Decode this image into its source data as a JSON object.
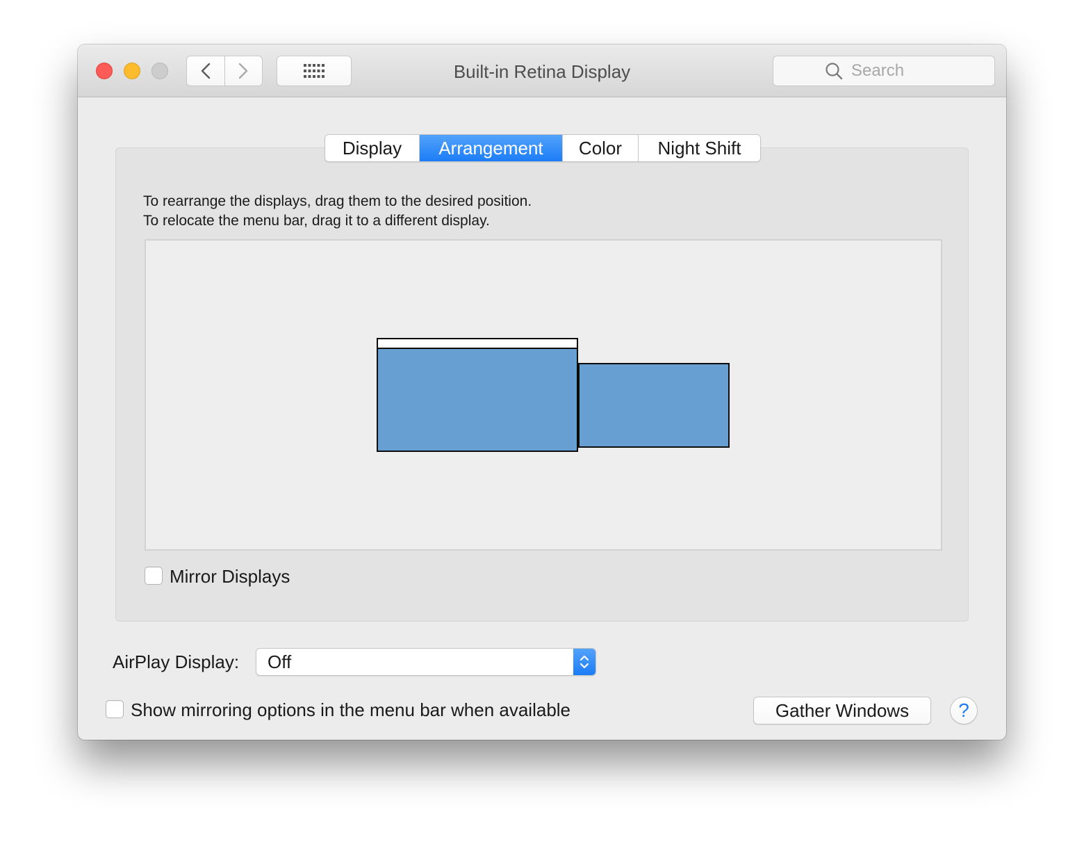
{
  "window": {
    "title": "Built-in Retina Display",
    "traffic_lights": {
      "close_color": "#fc5b57",
      "minimize_color": "#fdbb2e",
      "zoom_color": "#cdcdcd"
    }
  },
  "toolbar": {
    "back_icon": "chevron-left-icon",
    "forward_icon": "chevron-right-icon",
    "show_all_icon": "grid-icon",
    "search": {
      "placeholder": "Search",
      "value": "",
      "icon": "search-icon"
    }
  },
  "tabs": [
    {
      "label": "Display",
      "active": false
    },
    {
      "label": "Arrangement",
      "active": true
    },
    {
      "label": "Color",
      "active": false
    },
    {
      "label": "Night Shift",
      "active": false
    }
  ],
  "arrangement": {
    "instruction_line1": "To rearrange the displays, drag them to the desired position.",
    "instruction_line2": "To relocate the menu bar, drag it to a different display.",
    "display_color": "#689fd3",
    "mirror_displays": {
      "label": "Mirror Displays",
      "checked": false
    }
  },
  "airplay": {
    "label": "AirPlay Display:",
    "selected": "Off"
  },
  "mirroring_options": {
    "label": "Show mirroring options in the menu bar when available",
    "checked": false
  },
  "buttons": {
    "gather_windows": "Gather Windows",
    "help": "?"
  },
  "accent_color": "#1c7df6"
}
